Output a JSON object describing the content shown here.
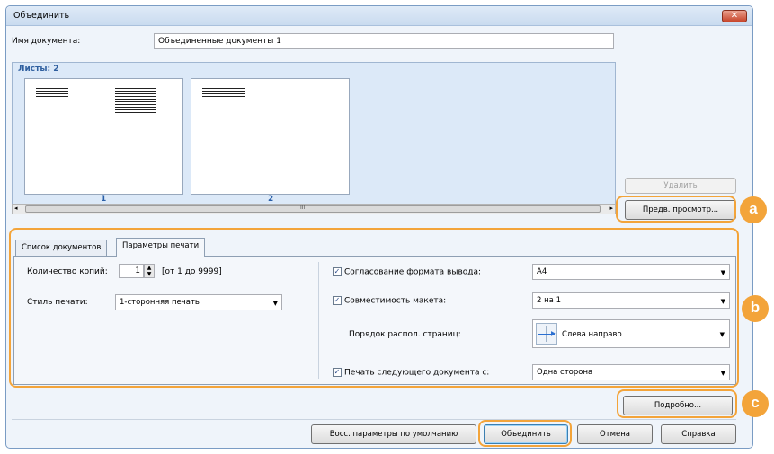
{
  "window": {
    "title": "Объединить",
    "close": "✕"
  },
  "doc_name": {
    "label": "Имя документа:",
    "value": "Объединенные документы 1"
  },
  "sheets": {
    "label": "Листы: 2",
    "pages": [
      {
        "number": "1"
      },
      {
        "number": "2"
      }
    ]
  },
  "buttons": {
    "delete": "Удалить",
    "preview": "Предв. просмотр...",
    "details": "Подробно...",
    "restore_defaults": "Восс. параметры по умолчанию",
    "merge": "Объединить",
    "cancel": "Отмена",
    "help": "Справка"
  },
  "tabs": [
    {
      "label": "Список документов"
    },
    {
      "label": "Параметры печати"
    }
  ],
  "print": {
    "copies_label": "Количество копий:",
    "copies_value": "1",
    "copies_range": "[от 1 до 9999]",
    "style_label": "Стиль печати:",
    "style_value": "1-сторонняя печать",
    "output_size_label": "Согласование формата вывода:",
    "output_size_value": "A4",
    "layout_label": "Совместимость макета:",
    "layout_value": "2 на 1",
    "order_label": "Порядок распол. страниц:",
    "order_value": "Слева направо",
    "next_doc_label": "Печать следующего документа с:",
    "next_doc_value": "Одна сторона"
  },
  "scroll": {
    "mid": "III"
  },
  "callouts": [
    "a",
    "b",
    "c"
  ]
}
